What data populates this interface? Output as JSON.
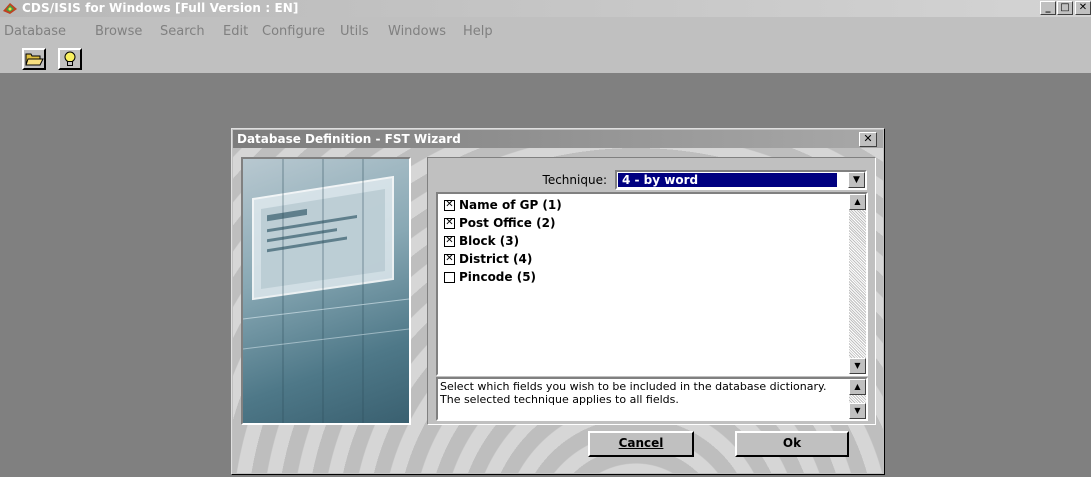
{
  "app": {
    "title": "CDS/ISIS for Windows [Full Version : EN]",
    "window_buttons": {
      "minimize": "_",
      "maximize": "□",
      "close": "✕"
    }
  },
  "menu": [
    "Database",
    "Browse",
    "Search",
    "Edit",
    "Configure",
    "Utils",
    "Windows",
    "Help"
  ],
  "toolbar": {
    "open_icon": "folder-open-icon",
    "hint_icon": "lightbulb-icon"
  },
  "dialog": {
    "title": "Database Definition - FST Wizard",
    "close_label": "✕",
    "technique_label": "Technique:",
    "technique_value": "4 - by word",
    "fields": [
      {
        "label": "Name of GP (1)",
        "checked": true
      },
      {
        "label": "Post Office (2)",
        "checked": true
      },
      {
        "label": "Block (3)",
        "checked": true
      },
      {
        "label": "District (4)",
        "checked": true
      },
      {
        "label": "Pincode (5)",
        "checked": false
      }
    ],
    "help_text": "Select which fields you wish to be included in the database dictionary. The selected technique applies to all fields.",
    "cancel_label": "Cancel",
    "ok_label": "Ok"
  },
  "colors": {
    "selection": "#000080",
    "face": "#c0c0c0",
    "desktop": "#808080"
  }
}
